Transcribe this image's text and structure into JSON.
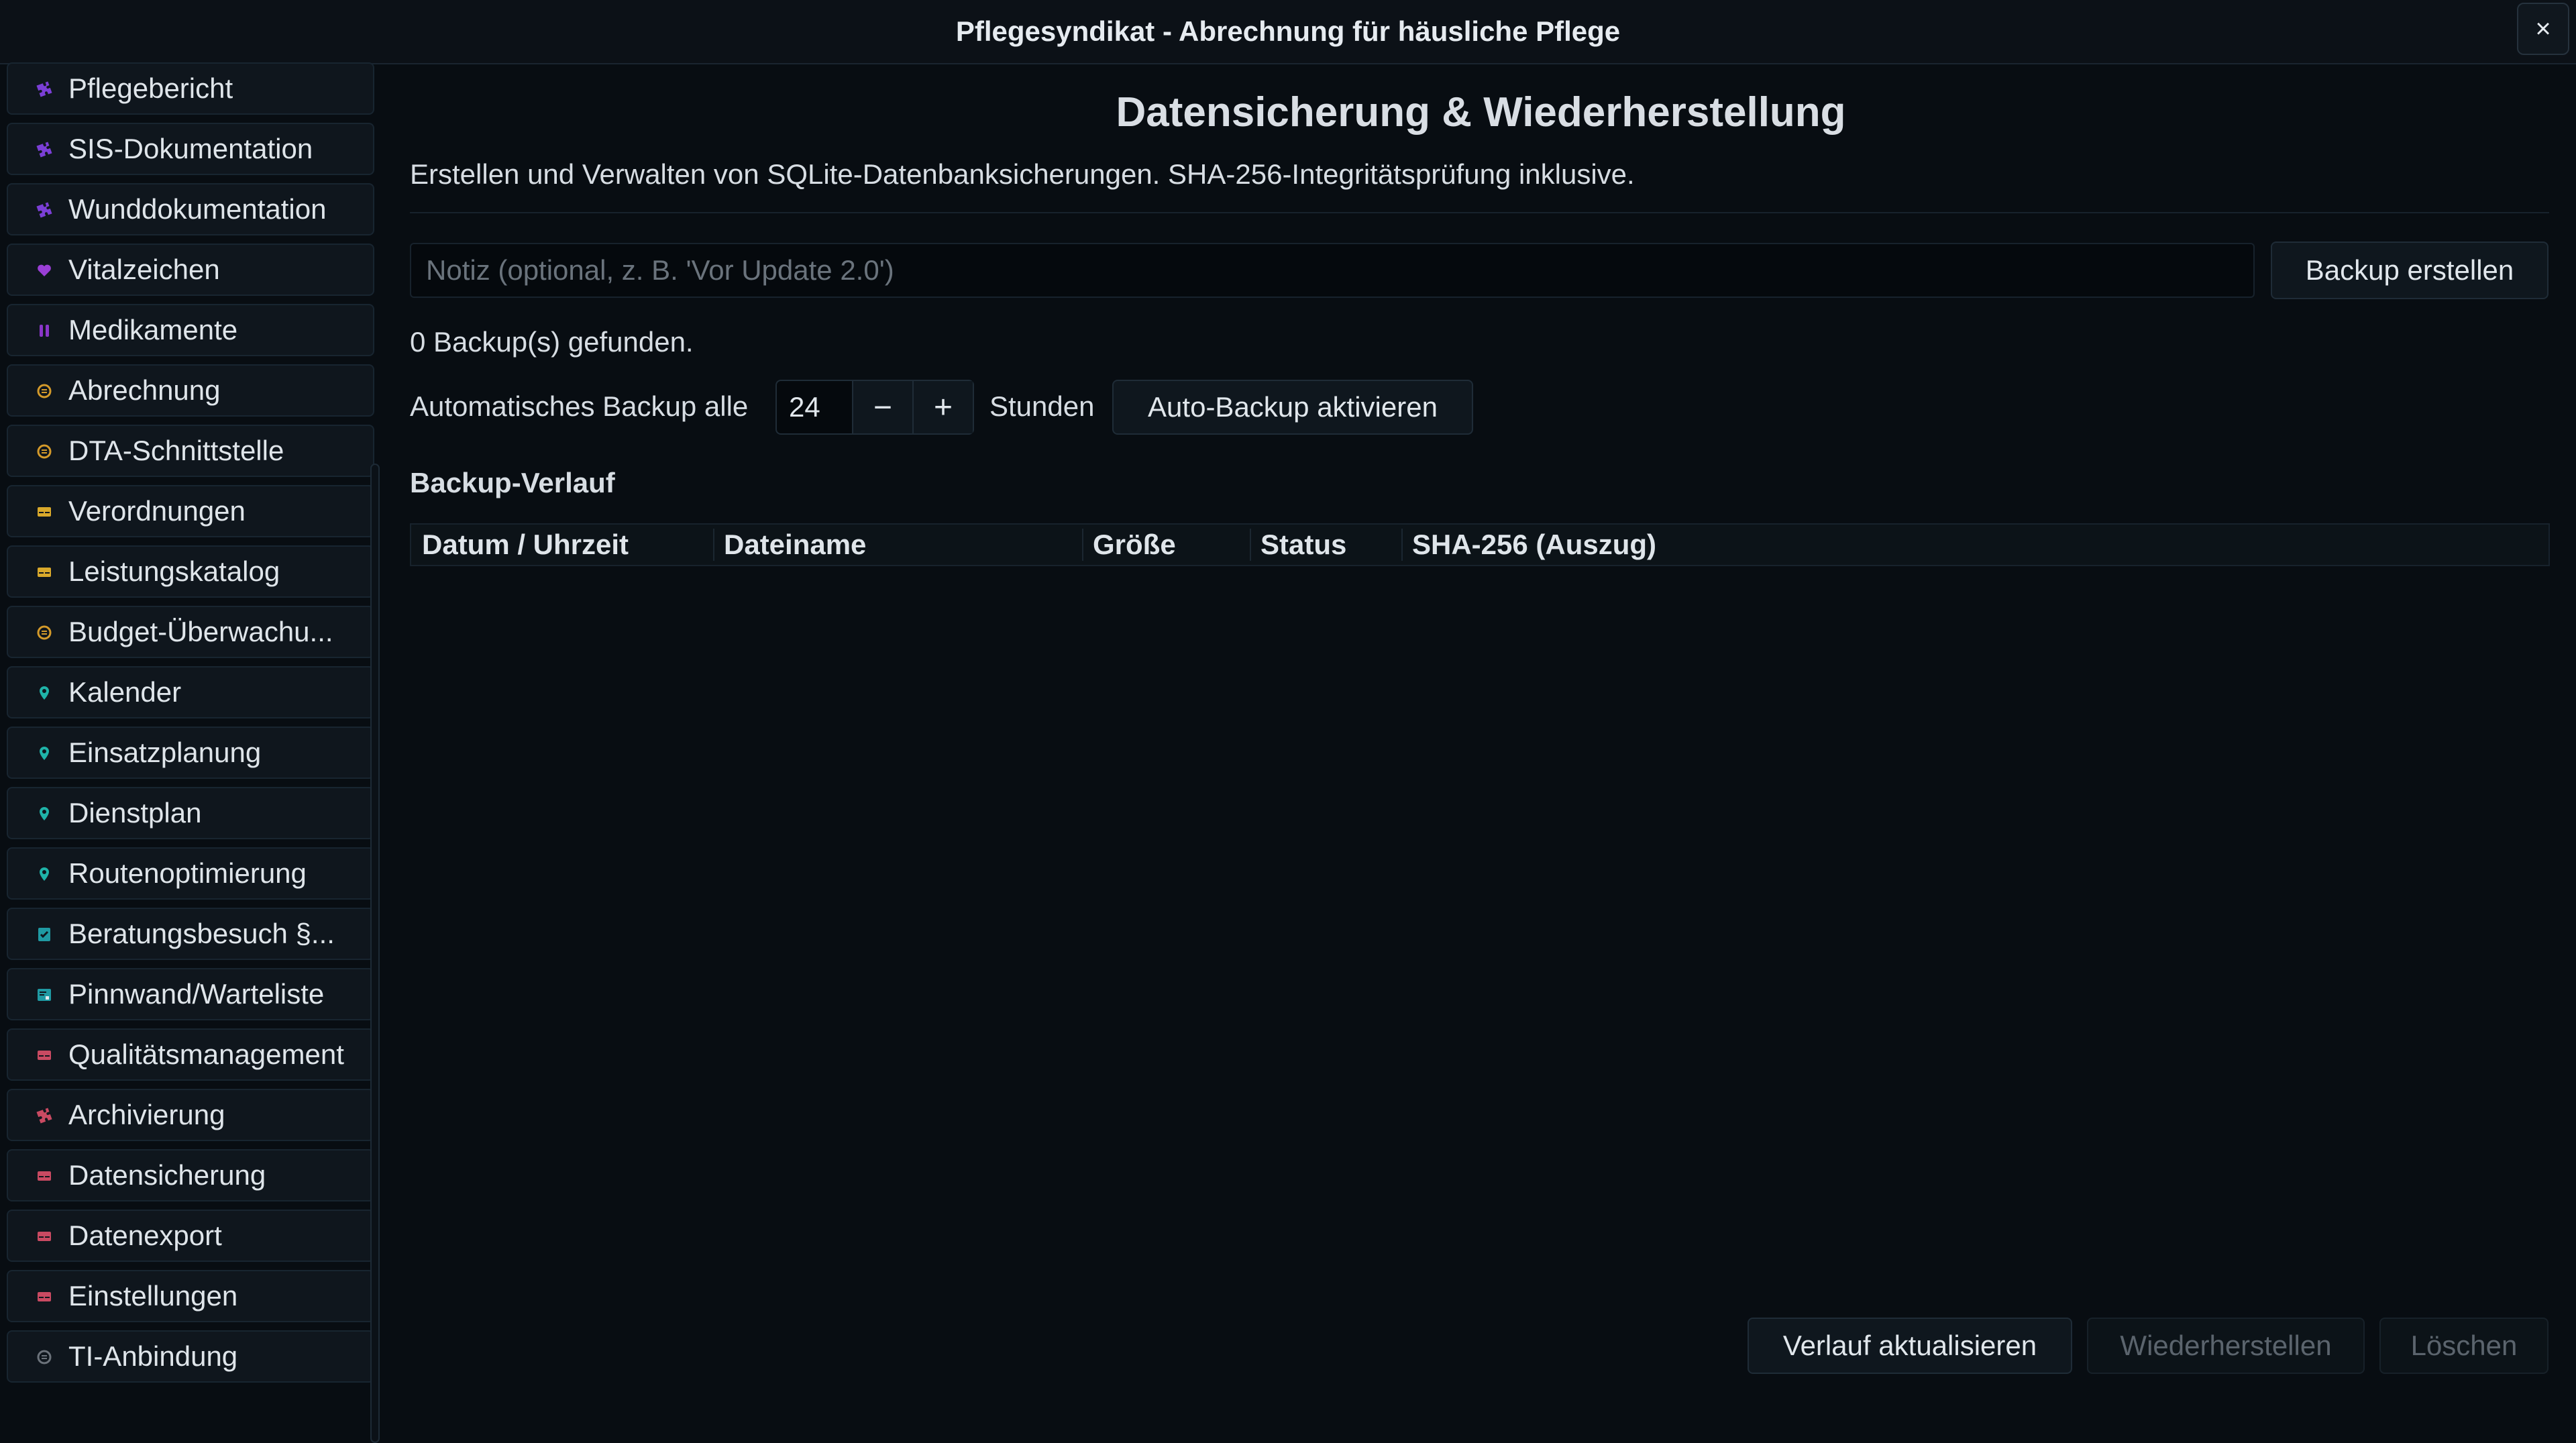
{
  "window": {
    "title": "Pflegesyndikat - Abrechnung für häusliche Pflege",
    "close_label": "×"
  },
  "sidebar": {
    "items": [
      {
        "label": "Pflegebericht",
        "icon": "puzzle-icon",
        "color": "#7b3fd6"
      },
      {
        "label": "SIS-Dokumentation",
        "icon": "puzzle-icon",
        "color": "#7b3fd6"
      },
      {
        "label": "Wunddokumentation",
        "icon": "puzzle-icon",
        "color": "#7b3fd6"
      },
      {
        "label": "Vitalzeichen",
        "icon": "heart-icon",
        "color": "#9a3fd6"
      },
      {
        "label": "Medikamente",
        "icon": "pill-icon",
        "color": "#8a36c9"
      },
      {
        "label": "Abrechnung",
        "icon": "coin-icon",
        "color": "#d49a2a"
      },
      {
        "label": "DTA-Schnittstelle",
        "icon": "coin-icon",
        "color": "#d49a2a"
      },
      {
        "label": "Verordnungen",
        "icon": "card-icon",
        "color": "#d9a92b"
      },
      {
        "label": "Leistungskatalog",
        "icon": "card-icon",
        "color": "#d9a92b"
      },
      {
        "label": "Budget-Überwachu...",
        "icon": "coin-icon",
        "color": "#d49a2a"
      },
      {
        "label": "Kalender",
        "icon": "pin-icon",
        "color": "#1fb3a8"
      },
      {
        "label": "Einsatzplanung",
        "icon": "pin-icon",
        "color": "#1fb3a8"
      },
      {
        "label": "Dienstplan",
        "icon": "pin-icon",
        "color": "#1fb3a8"
      },
      {
        "label": "Routenoptimierung",
        "icon": "pin-icon",
        "color": "#1fb3a8"
      },
      {
        "label": "Beratungsbesuch §...",
        "icon": "checkbox-icon",
        "color": "#1f9aa3"
      },
      {
        "label": "Pinnwand/Warteliste",
        "icon": "board-icon",
        "color": "#1f9aa3"
      },
      {
        "label": "Qualitätsmanagement",
        "icon": "card-icon",
        "color": "#c94a62"
      },
      {
        "label": "Archivierung",
        "icon": "puzzle-icon",
        "color": "#c94a62"
      },
      {
        "label": "Datensicherung",
        "icon": "card-icon",
        "color": "#c94a62"
      },
      {
        "label": "Datenexport",
        "icon": "card-icon",
        "color": "#c94a62"
      },
      {
        "label": "Einstellungen",
        "icon": "card-icon",
        "color": "#c94a62"
      },
      {
        "label": "TI-Anbindung",
        "icon": "coin-icon",
        "color": "#6b727a"
      }
    ]
  },
  "main": {
    "heading": "Datensicherung & Wiederherstellung",
    "subtitle": "Erstellen und Verwalten von SQLite-Datenbanksicherungen. SHA-256-Integritätsprüfung inklusive.",
    "note_placeholder": "Notiz (optional, z. B. 'Vor Update 2.0')",
    "note_value": "",
    "create_button": "Backup erstellen",
    "count_text": "0 Backup(s) gefunden.",
    "auto_label": "Automatisches Backup alle",
    "interval_value": "24",
    "decrement_label": "−",
    "increment_label": "+",
    "hours_label": "Stunden",
    "auto_button": "Auto-Backup aktivieren",
    "history_title": "Backup-Verlauf",
    "table_headers": [
      "Datum / Uhrzeit",
      "Dateiname",
      "Größe",
      "Status",
      "SHA-256 (Auszug)"
    ],
    "refresh_button": "Verlauf aktualisieren",
    "restore_button": "Wiederherstellen",
    "delete_button": "Löschen"
  }
}
